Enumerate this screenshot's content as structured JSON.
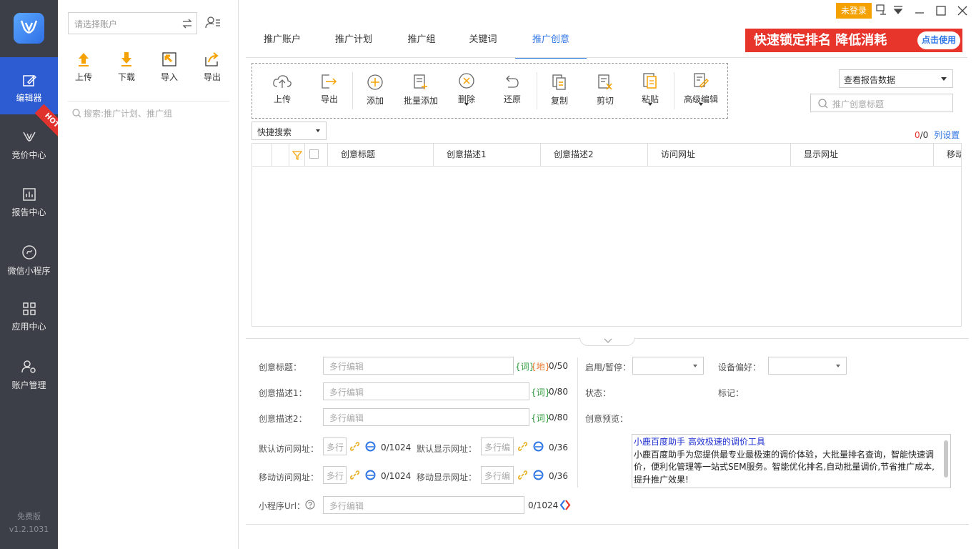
{
  "rail": {
    "items": [
      {
        "label": "编辑器",
        "icon": "edit-icon"
      },
      {
        "label": "竞价中心",
        "icon": "bid-icon"
      },
      {
        "label": "报告中心",
        "icon": "report-icon"
      },
      {
        "label": "微信小程序",
        "icon": "miniprogram-icon"
      },
      {
        "label": "应用中心",
        "icon": "apps-icon"
      },
      {
        "label": "账户管理",
        "icon": "account-settings-icon"
      }
    ],
    "hot_badge": "HOT",
    "edition": "免费版",
    "version": "v1.2.1031"
  },
  "account_panel": {
    "select_placeholder": "请选择账户",
    "tools": [
      {
        "label": "上传"
      },
      {
        "label": "下载"
      },
      {
        "label": "导入"
      },
      {
        "label": "导出"
      }
    ],
    "search_placeholder": "搜索:推广计划、推广组"
  },
  "topbar": {
    "login": "未登录",
    "banner_text": "快速锁定排名 降低消耗",
    "banner_button": "点击使用"
  },
  "tabs": [
    {
      "label": "推广账户"
    },
    {
      "label": "推广计划"
    },
    {
      "label": "推广组"
    },
    {
      "label": "关键词"
    },
    {
      "label": "推广创意"
    }
  ],
  "toolbar": {
    "buttons": [
      {
        "label": "上传"
      },
      {
        "label": "导出"
      },
      {
        "label": "添加"
      },
      {
        "label": "批量添加"
      },
      {
        "label": "删除"
      },
      {
        "label": "还原"
      },
      {
        "label": "复制"
      },
      {
        "label": "剪切"
      },
      {
        "label": "粘贴"
      },
      {
        "label": "高级编辑"
      }
    ]
  },
  "report_select": "查看报告数据",
  "creative_search_placeholder": "推广创意标题",
  "quick_search": "快捷搜索",
  "count": {
    "selected": "0",
    "total": "/0"
  },
  "column_settings": "列设置",
  "grid": {
    "columns": [
      "创意标题",
      "创意描述1",
      "创意描述2",
      "访问网址",
      "显示网址",
      "移动"
    ]
  },
  "form": {
    "title_label": "创意标题：",
    "desc1_label": "创意描述1：",
    "desc2_label": "创意描述2：",
    "default_url_label": "默认访问网址：",
    "default_display_label": "默认显示网址：",
    "mobile_url_label": "移动访问网址：",
    "mobile_display_label": "移动显示网址：",
    "mini_url_label": "小程序Url：",
    "placeholder": "多行编辑",
    "placeholder_short": "多行",
    "placeholder_mid": "多行编",
    "tag_word": "{词}",
    "tag_region": "{地}",
    "title_count": "0/50",
    "desc1_count": "0/80",
    "desc2_count": "0/80",
    "url_count": "0/1024",
    "display_count": "0/36",
    "mini_count": "0/1024",
    "enable_label": "启用/暂停：",
    "device_label": "设备偏好：",
    "status_label": "状态：",
    "mark_label": "标记：",
    "preview_label": "创意预览："
  },
  "preview": {
    "title": "小鹿百度助手 高效极速的调价工具",
    "body": "小鹿百度助手为您提供最专业最极速的调价体验，大批量排名查询，智能快速调价，便利化管理等一站式SEM服务。智能优化排名,自动批量调价,节省推广成本,提升推广效果!"
  },
  "colors": {
    "rail_bg": "#3c3f47",
    "accent": "#2f76e6",
    "banner": "#e8352c",
    "login": "#f5a100"
  }
}
